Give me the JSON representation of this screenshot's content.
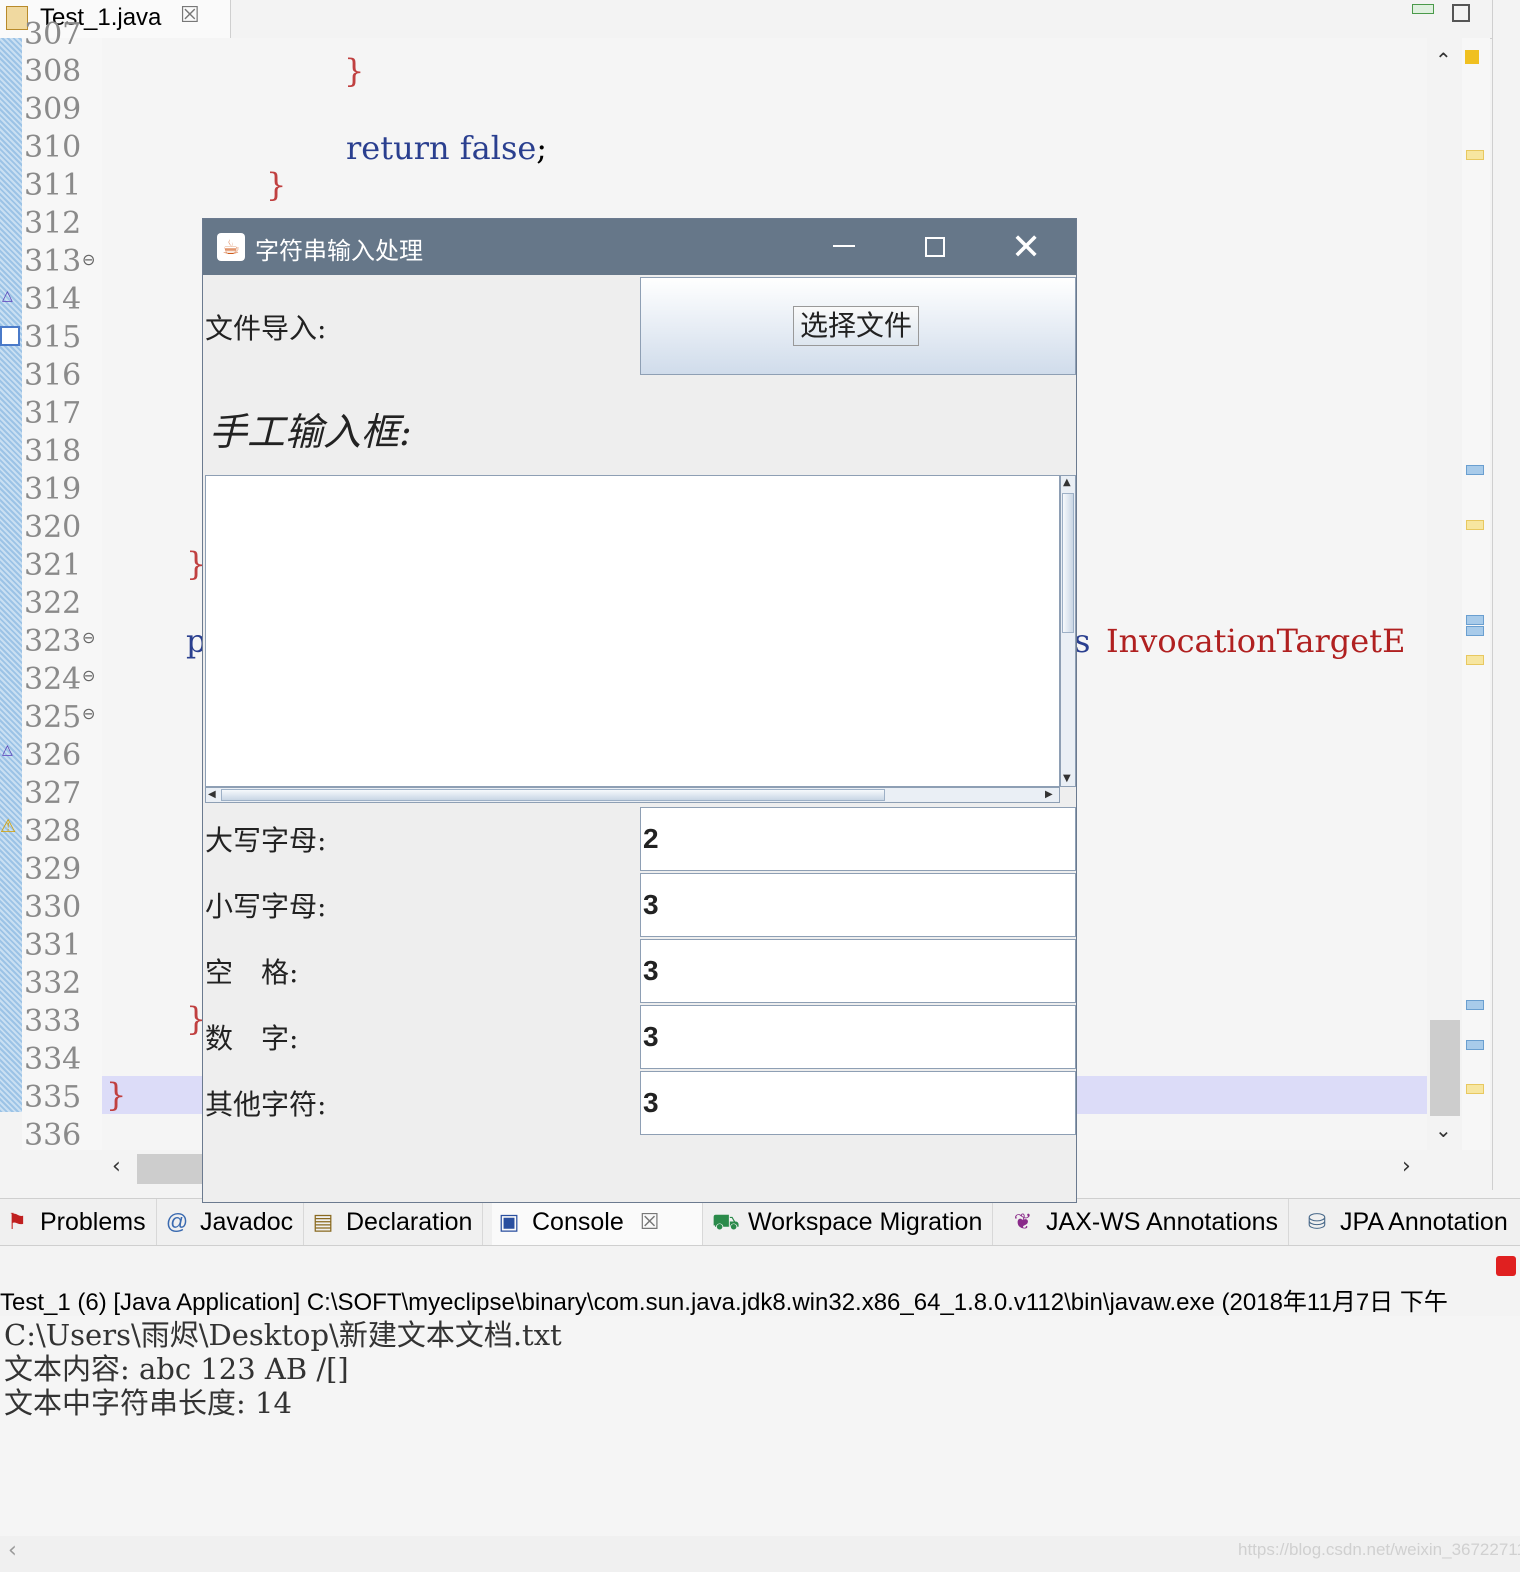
{
  "editor": {
    "tab_label": "Test_1.java",
    "tab_close": "☒",
    "line_numbers": [
      "308",
      "309",
      "310",
      "311",
      "312",
      "313",
      "314",
      "315",
      "316",
      "317",
      "318",
      "319",
      "320",
      "321",
      "322",
      "323",
      "324",
      "325",
      "326",
      "327",
      "328",
      "329",
      "330",
      "331",
      "332",
      "333",
      "334",
      "335",
      "336"
    ],
    "partial_top_line": "307",
    "code": {
      "brace_308": "}",
      "return_310_kw": "return",
      "return_310_val": "false",
      "return_310_semi": ";",
      "brace_311": "}",
      "brace_321": "}",
      "p_323": "p",
      "s_323": "s",
      "invocation_323": "InvocationTargetE",
      "brace_333": "}",
      "brace_335": "}"
    }
  },
  "dialog": {
    "title": "字符串输入处理",
    "title_icon": "java-cup-icon",
    "file_import_label": "文件导入:",
    "choose_file_button": "选择文件",
    "manual_input_label": "手工输入框:",
    "textarea_value": "",
    "stats": [
      {
        "label": "大写字母:",
        "value": "2"
      },
      {
        "label": "小写字母:",
        "value": "3"
      },
      {
        "label": "空　格:",
        "value": "3"
      },
      {
        "label": "数　字:",
        "value": "3"
      },
      {
        "label": "其他字符:",
        "value": "3"
      }
    ]
  },
  "views": {
    "tabs": [
      {
        "label": "Problems",
        "icon": "problems-icon"
      },
      {
        "label": "Javadoc",
        "icon": "at-icon"
      },
      {
        "label": "Declaration",
        "icon": "declaration-icon"
      },
      {
        "label": "Console",
        "icon": "console-icon"
      },
      {
        "label": "Workspace Migration",
        "icon": "migration-icon"
      },
      {
        "label": "JAX-WS Annotations",
        "icon": "jaxws-icon"
      },
      {
        "label": "JPA Annotation",
        "icon": "jpa-icon"
      }
    ],
    "console_close": "☒"
  },
  "console": {
    "info": "Test_1 (6) [Java Application] C:\\SOFT\\myeclipse\\binary\\com.sun.java.jdk8.win32.x86_64_1.8.0.v112\\bin\\javaw.exe (2018年11月7日 下午",
    "lines": [
      "C:\\Users\\雨烬\\Desktop\\新建文本文档.txt",
      "文本内容: abc 123 AB /[]",
      "文本中字符串长度: 14"
    ]
  },
  "watermark": "https://blog.csdn.net/weixin_36722711"
}
